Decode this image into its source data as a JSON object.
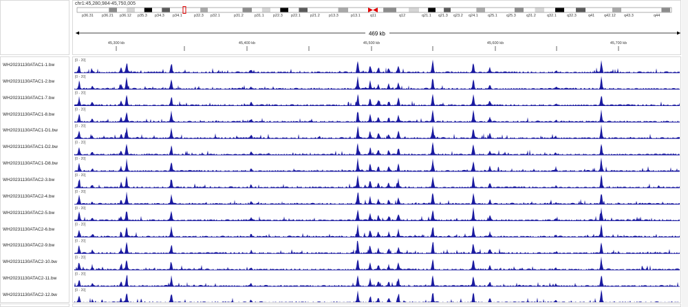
{
  "locus": "chr1:45,280,984-45,750,005",
  "bands": [
    "p36.31",
    "p36.21",
    "p36.12",
    "p35.3",
    "p34.3",
    "p34.1",
    "p32.3",
    "p32.1",
    "p31.2",
    "p31.1",
    "p22.3",
    "p22.1",
    "p21.2",
    "p13.3",
    "p13.1",
    "q11",
    "q12",
    "q21.1",
    "q21.3",
    "q23.2",
    "q24.1",
    "q25.1",
    "q25.3",
    "q31.2",
    "q32.1",
    "q32.3",
    "q41",
    "q42.12",
    "q43.3",
    "q44"
  ],
  "span_label": "469 kb",
  "ruler_ticks": [
    "45,300 kb",
    "45,400 kb",
    "45,500 kb",
    "45,600 kb",
    "45,700 kb"
  ],
  "data_range": "[0 - 20]",
  "tracks": [
    "WH20231130ATAC1-1.bw",
    "WH20231130ATAC1-2.bw",
    "WH20231130ATAC1-7.bw",
    "WH20231130ATAC1-8.bw",
    "WH20231130ATAC1-D1.bw",
    "WH20231130ATAC1-D2.bw",
    "WH20231130ATAC1-D8.bw",
    "WH20231130ATAC2-3.bw",
    "WH20231130ATAC2-4.bw",
    "WH20231130ATAC2-5.bw",
    "WH20231130ATAC2-6.bw",
    "WH20231130ATAC2-9.bw",
    "WH20231130ATAC2-10.bw",
    "WH20231130ATAC2-11.bw",
    "WH20231130ATAC2-12.bw"
  ],
  "colors": {
    "signal": "#1a1aa0",
    "highlight": "#e00000"
  }
}
